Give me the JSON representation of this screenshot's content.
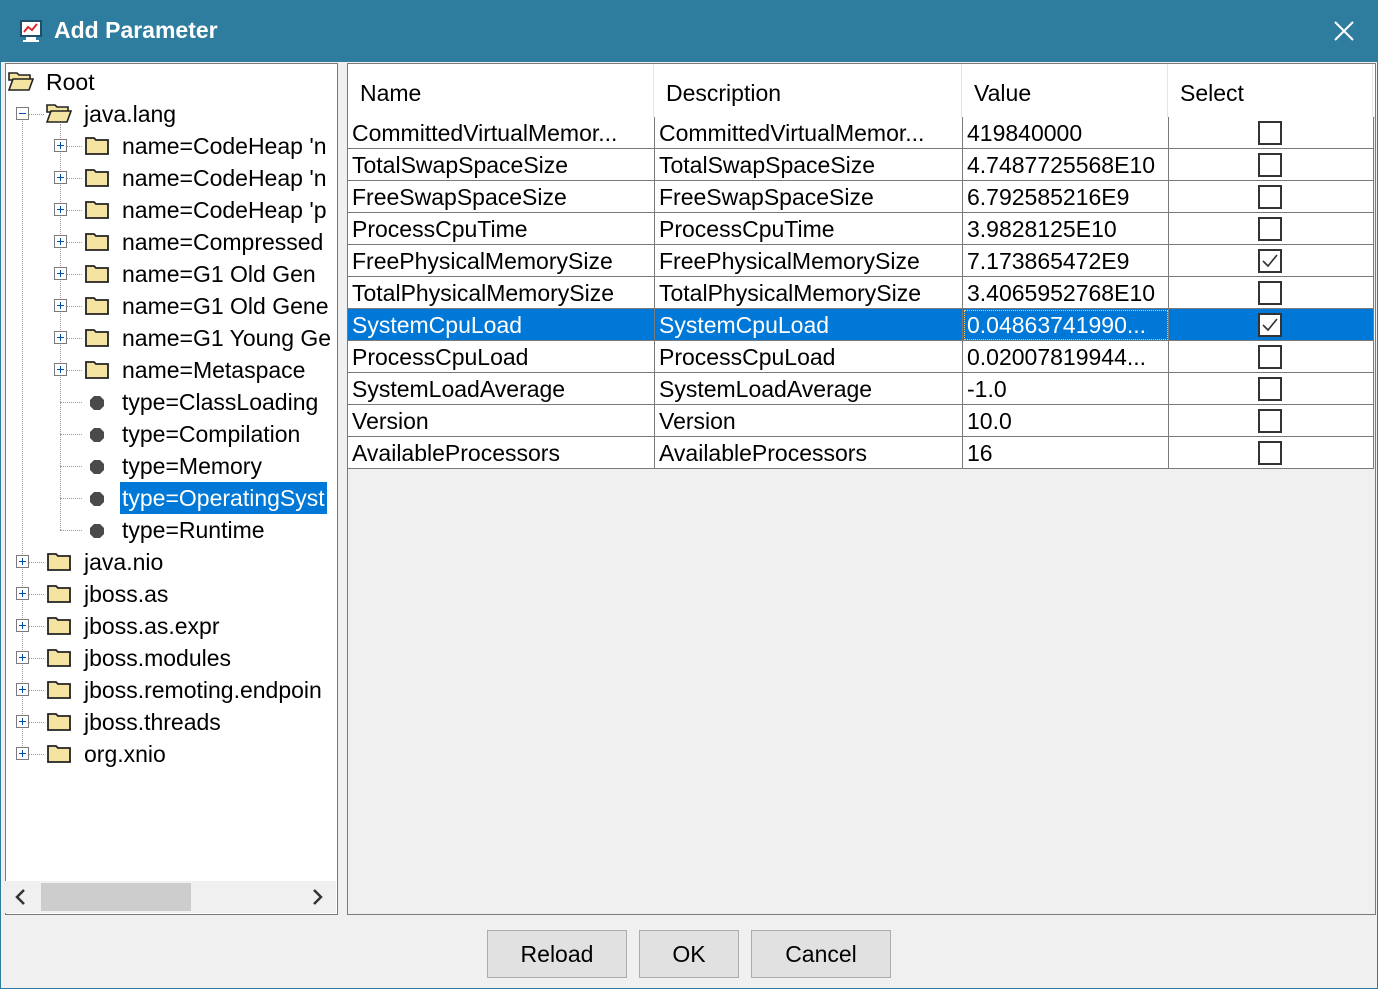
{
  "window": {
    "title": "Add Parameter"
  },
  "tree": {
    "nodes": [
      {
        "label": "Root",
        "depth": 0,
        "kind": "folder-open",
        "expander": "none"
      },
      {
        "label": "java.lang",
        "depth": 1,
        "kind": "folder-open",
        "expander": "minus"
      },
      {
        "label": "name=CodeHeap 'n",
        "depth": 2,
        "kind": "folder",
        "expander": "plus"
      },
      {
        "label": "name=CodeHeap 'n",
        "depth": 2,
        "kind": "folder",
        "expander": "plus"
      },
      {
        "label": "name=CodeHeap 'p",
        "depth": 2,
        "kind": "folder",
        "expander": "plus"
      },
      {
        "label": "name=Compressed",
        "depth": 2,
        "kind": "folder",
        "expander": "plus"
      },
      {
        "label": "name=G1 Old Gen",
        "depth": 2,
        "kind": "folder",
        "expander": "plus"
      },
      {
        "label": "name=G1 Old Gene",
        "depth": 2,
        "kind": "folder",
        "expander": "plus"
      },
      {
        "label": "name=G1 Young Ge",
        "depth": 2,
        "kind": "folder",
        "expander": "plus"
      },
      {
        "label": "name=Metaspace",
        "depth": 2,
        "kind": "folder",
        "expander": "plus"
      },
      {
        "label": "type=ClassLoading",
        "depth": 2,
        "kind": "leaf",
        "expander": "none"
      },
      {
        "label": "type=Compilation",
        "depth": 2,
        "kind": "leaf",
        "expander": "none"
      },
      {
        "label": "type=Memory",
        "depth": 2,
        "kind": "leaf",
        "expander": "none"
      },
      {
        "label": "type=OperatingSyst",
        "depth": 2,
        "kind": "leaf",
        "expander": "none",
        "selected": true
      },
      {
        "label": "type=Runtime",
        "depth": 2,
        "kind": "leaf",
        "expander": "none"
      },
      {
        "label": "java.nio",
        "depth": 1,
        "kind": "folder",
        "expander": "plus"
      },
      {
        "label": "jboss.as",
        "depth": 1,
        "kind": "folder",
        "expander": "plus"
      },
      {
        "label": "jboss.as.expr",
        "depth": 1,
        "kind": "folder",
        "expander": "plus"
      },
      {
        "label": "jboss.modules",
        "depth": 1,
        "kind": "folder",
        "expander": "plus"
      },
      {
        "label": "jboss.remoting.endpoin",
        "depth": 1,
        "kind": "folder",
        "expander": "plus"
      },
      {
        "label": "jboss.threads",
        "depth": 1,
        "kind": "folder",
        "expander": "plus"
      },
      {
        "label": "org.xnio",
        "depth": 1,
        "kind": "folder",
        "expander": "plus"
      }
    ]
  },
  "table": {
    "columns": [
      "Name",
      "Description",
      "Value",
      "Select"
    ],
    "rows": [
      {
        "name": "CommittedVirtualMemor...",
        "description": "CommittedVirtualMemor...",
        "value": "419840000",
        "checked": false
      },
      {
        "name": "TotalSwapSpaceSize",
        "description": "TotalSwapSpaceSize",
        "value": "4.7487725568E10",
        "checked": false
      },
      {
        "name": "FreeSwapSpaceSize",
        "description": "FreeSwapSpaceSize",
        "value": "6.792585216E9",
        "checked": false
      },
      {
        "name": "ProcessCpuTime",
        "description": "ProcessCpuTime",
        "value": "3.9828125E10",
        "checked": false
      },
      {
        "name": "FreePhysicalMemorySize",
        "description": "FreePhysicalMemorySize",
        "value": "7.173865472E9",
        "checked": true
      },
      {
        "name": "TotalPhysicalMemorySize",
        "description": "TotalPhysicalMemorySize",
        "value": "3.4065952768E10",
        "checked": false
      },
      {
        "name": "SystemCpuLoad",
        "description": "SystemCpuLoad",
        "value": "0.04863741990...",
        "checked": true,
        "selected": true
      },
      {
        "name": "ProcessCpuLoad",
        "description": "ProcessCpuLoad",
        "value": "0.02007819944...",
        "checked": false
      },
      {
        "name": "SystemLoadAverage",
        "description": "SystemLoadAverage",
        "value": "-1.0",
        "checked": false
      },
      {
        "name": "Version",
        "description": "Version",
        "value": "10.0",
        "checked": false
      },
      {
        "name": "AvailableProcessors",
        "description": "AvailableProcessors",
        "value": "16",
        "checked": false
      }
    ]
  },
  "buttons": {
    "reload": "Reload",
    "ok": "OK",
    "cancel": "Cancel"
  },
  "colors": {
    "titlebar": "#2f7d9e",
    "selection": "#0078d7",
    "folder": "#f5e3a1"
  }
}
